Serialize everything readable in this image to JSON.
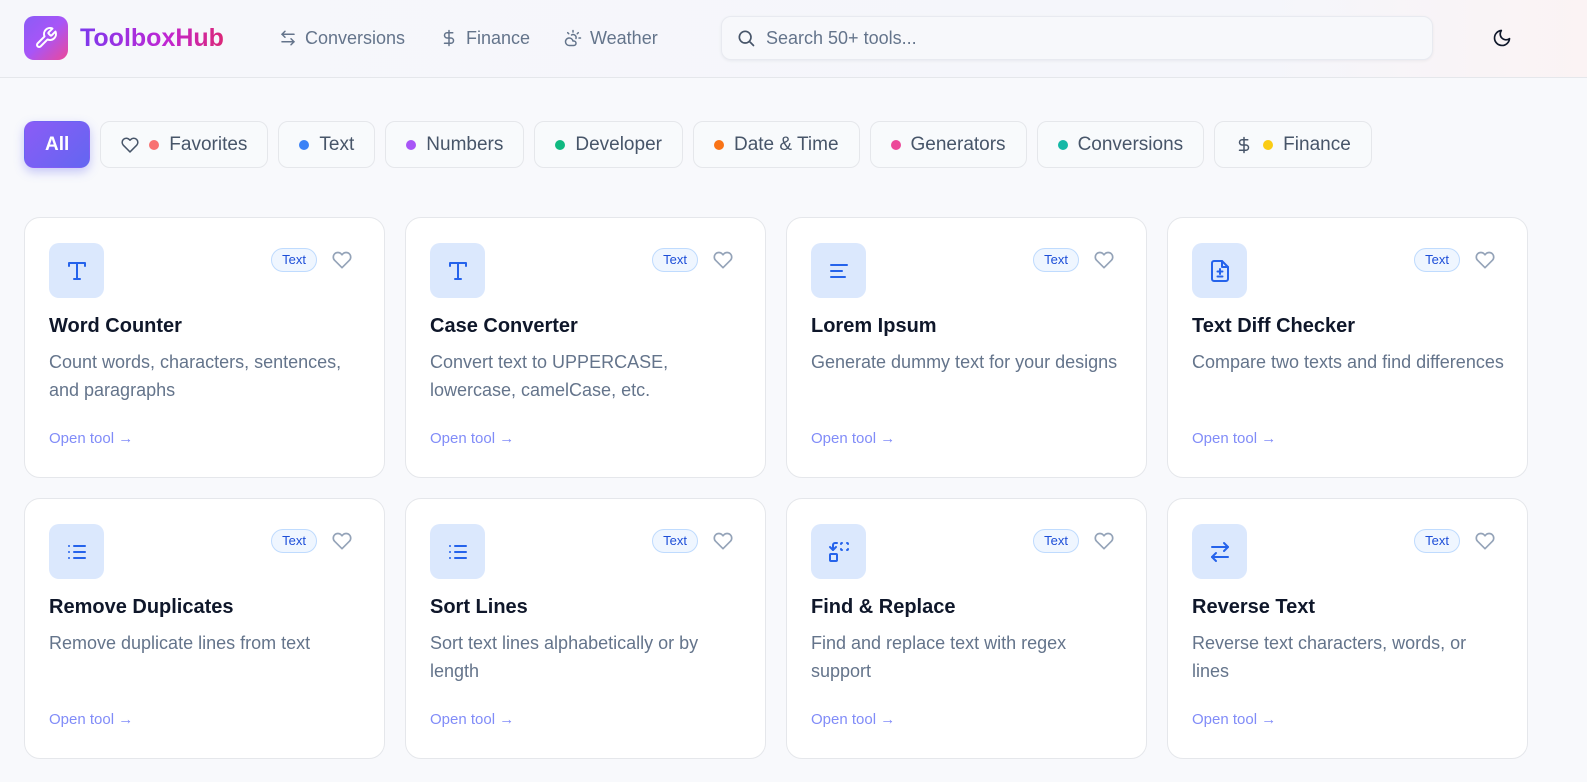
{
  "app": {
    "name": "ToolboxHub"
  },
  "nav": [
    {
      "label": "Conversions",
      "icon": "swap-arrows-icon"
    },
    {
      "label": "Finance",
      "icon": "dollar-icon"
    },
    {
      "label": "Weather",
      "icon": "cloud-sun-icon"
    }
  ],
  "search": {
    "placeholder": "Search 50+ tools..."
  },
  "filters": [
    {
      "label": "All",
      "active": true
    },
    {
      "label": "Favorites",
      "dot": "#f87171",
      "icon": "heart-icon"
    },
    {
      "label": "Text",
      "dot": "#3b82f6"
    },
    {
      "label": "Numbers",
      "dot": "#a855f7"
    },
    {
      "label": "Developer",
      "dot": "#10b981"
    },
    {
      "label": "Date & Time",
      "dot": "#f97316"
    },
    {
      "label": "Generators",
      "dot": "#ec4899"
    },
    {
      "label": "Conversions",
      "dot": "#14b8a6"
    },
    {
      "label": "Finance",
      "dot": "#facc15",
      "icon": "dollar-icon"
    }
  ],
  "tools": [
    {
      "title": "Word Counter",
      "description": "Count words, characters, sentences, and paragraphs",
      "badge": "Text",
      "link": "Open tool →",
      "icon": "type-icon"
    },
    {
      "title": "Case Converter",
      "description": "Convert text to UPPERCASE, lowercase, camelCase, etc.",
      "badge": "Text",
      "link": "Open tool →",
      "icon": "type-icon"
    },
    {
      "title": "Lorem Ipsum",
      "description": "Generate dummy text for your designs",
      "badge": "Text",
      "link": "Open tool →",
      "icon": "align-left-icon"
    },
    {
      "title": "Text Diff Checker",
      "description": "Compare two texts and find differences",
      "badge": "Text",
      "link": "Open tool →",
      "icon": "file-diff-icon"
    },
    {
      "title": "Remove Duplicates",
      "description": "Remove duplicate lines from text",
      "badge": "Text",
      "link": "Open tool →",
      "icon": "list-icon"
    },
    {
      "title": "Sort Lines",
      "description": "Sort text lines alphabetically or by length",
      "badge": "Text",
      "link": "Open tool →",
      "icon": "list-icon"
    },
    {
      "title": "Find & Replace",
      "description": "Find and replace text with regex support",
      "badge": "Text",
      "link": "Open tool →",
      "icon": "replace-icon"
    },
    {
      "title": "Reverse Text",
      "description": "Reverse text characters, words, or lines",
      "badge": "Text",
      "link": "Open tool →",
      "icon": "swap-arrows-icon"
    }
  ],
  "colors": {
    "accent": "#6366f1",
    "iconBlue": "#2563eb",
    "iconBg": "#dbe8fd"
  }
}
